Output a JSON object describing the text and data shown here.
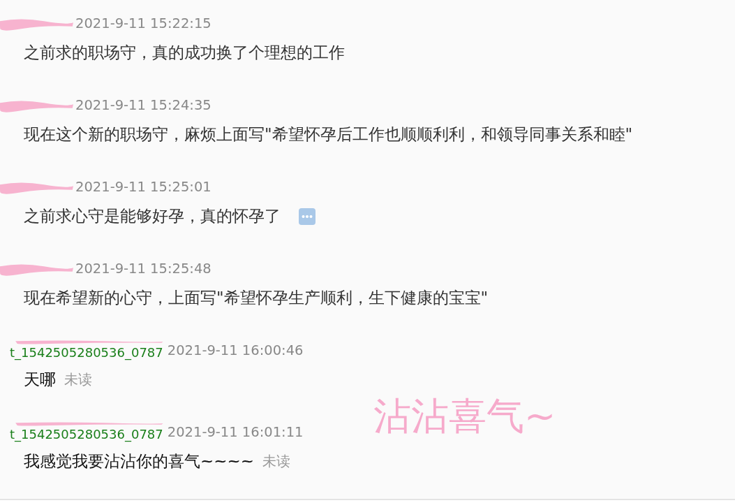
{
  "messages": [
    {
      "kind": "other",
      "sender": {
        "redacted": true
      },
      "time": "2021-9-11 15:22:15",
      "text": "之前求的职场守，真的成功换了个理想的工作"
    },
    {
      "kind": "other",
      "sender": {
        "redacted": true
      },
      "time": "2021-9-11 15:24:35",
      "text": "现在这个新的职场守，麻烦上面写\"希望怀孕后工作也顺顺利利，和领导同事关系和睦\""
    },
    {
      "kind": "other",
      "sender": {
        "redacted": true
      },
      "time": "2021-9-11 15:25:01",
      "text": "之前求心守是能够好孕，真的怀孕了",
      "more_icon": true
    },
    {
      "kind": "other",
      "sender": {
        "redacted": true
      },
      "time": "2021-9-11 15:25:48",
      "text": "现在希望新的心守，上面写\"希望怀孕生产顺利，生下健康的宝宝\""
    },
    {
      "kind": "self",
      "sender": {
        "name": "t_1542505280536_0787",
        "redacted": true
      },
      "time": "2021-9-11 16:00:46",
      "text": "天哪",
      "status": "未读"
    },
    {
      "kind": "self",
      "sender": {
        "name": "t_1542505280536_0787",
        "redacted": true
      },
      "time": "2021-9-11 16:01:11",
      "text": "我感觉我要沾沾你的喜气~~~~",
      "status": "未读"
    }
  ],
  "annotation": "沾沾喜气~"
}
